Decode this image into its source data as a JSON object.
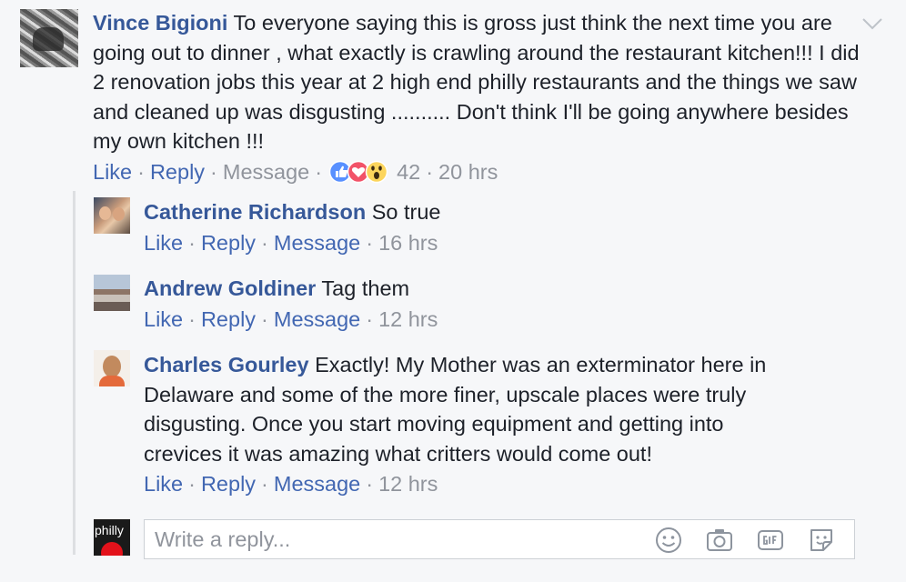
{
  "main_comment": {
    "author": "Vince Bigioni",
    "text": " To everyone saying this is gross just think the next time you are going out to dinner , what exactly is crawling around the restaurant kitchen!!! I did 2 renovation jobs this year at 2 high end philly restaurants and the things we saw and cleaned up was disgusting .......... Don't think I'll be going anywhere besides my own kitchen !!!",
    "actions": {
      "like": "Like",
      "reply": "Reply",
      "message": "Message"
    },
    "separator": "·",
    "reaction_count": "42",
    "reaction_icons": [
      "like-reaction-icon",
      "love-reaction-icon",
      "wow-reaction-icon"
    ],
    "time": "20 hrs"
  },
  "replies": [
    {
      "author": "Catherine Richardson",
      "text": " So true",
      "like": "Like",
      "reply": "Reply",
      "message": "Message",
      "time": "16 hrs"
    },
    {
      "author": "Andrew Goldiner",
      "text": " Tag them",
      "like": "Like",
      "reply": "Reply",
      "message": "Message",
      "time": "12 hrs"
    },
    {
      "author": "Charles Gourley",
      "text": " Exactly! My Mother was an exterminator here in Delaware and some of the more finer, upscale places were truly disgusting. Once you start moving equipment and getting into crevices it was amazing what critters would come out!",
      "like": "Like",
      "reply": "Reply",
      "message": "Message",
      "time": "12 hrs"
    }
  ],
  "composer": {
    "avatar_label": "philly",
    "placeholder": "Write a reply...",
    "tools": [
      "emoji-icon",
      "camera-icon",
      "gif-icon",
      "sticker-icon"
    ]
  },
  "colors": {
    "link": "#4267b2",
    "name": "#365899",
    "meta": "#90949c",
    "background": "#f6f7f9"
  }
}
